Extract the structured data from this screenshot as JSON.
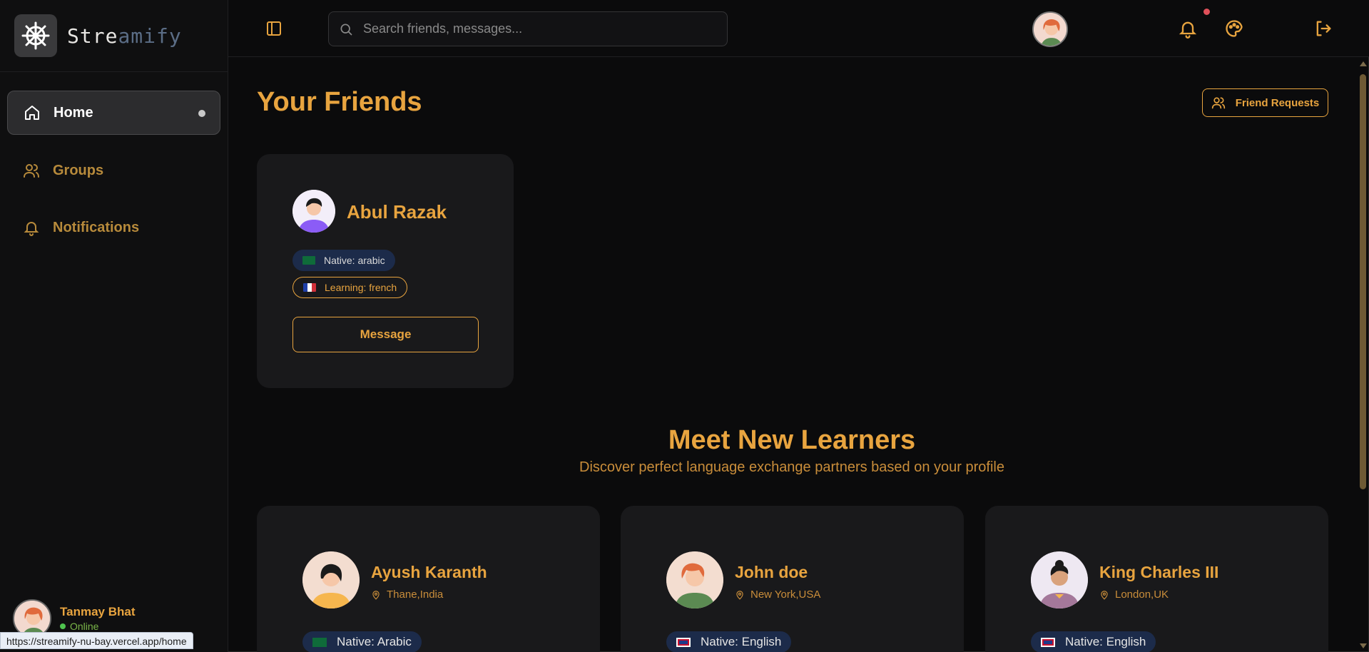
{
  "app": {
    "name_bright": "Stre",
    "name_mid": "amify"
  },
  "sidebar": {
    "items": [
      {
        "label": "Home",
        "icon": "home-icon",
        "active": true
      },
      {
        "label": "Groups",
        "icon": "users-icon"
      },
      {
        "label": "Notifications",
        "icon": "bell-icon"
      }
    ],
    "user": {
      "name": "Tanmay Bhat",
      "status": "Online"
    }
  },
  "status_url": "https://streamify-nu-bay.vercel.app/home",
  "topbar": {
    "search_placeholder": "Search friends, messages...",
    "icons": [
      "panel-toggle-icon",
      "search-icon",
      "bell-icon",
      "palette-icon",
      "avatar",
      "logout-icon"
    ]
  },
  "friends": {
    "title": "Your Friends",
    "requests_label": "Friend Requests",
    "cards": [
      {
        "name": "Abul Razak",
        "native": "Native: arabic",
        "learning": "Learning: french",
        "message_label": "Message"
      }
    ]
  },
  "learners": {
    "title": "Meet New Learners",
    "subtitle": "Discover perfect language exchange partners based on your profile",
    "cards": [
      {
        "name": "Ayush Karanth",
        "location": "Thane,India",
        "native": "Native: Arabic"
      },
      {
        "name": "John doe",
        "location": "New York,USA",
        "native": "Native: English"
      },
      {
        "name": "King Charles III",
        "location": "London,UK",
        "native": "Native: English"
      }
    ]
  },
  "colors": {
    "accent": "#e8a43f",
    "background": "#0b0b0c",
    "card": "#19191b",
    "badge_native": "#1c2b4a"
  }
}
